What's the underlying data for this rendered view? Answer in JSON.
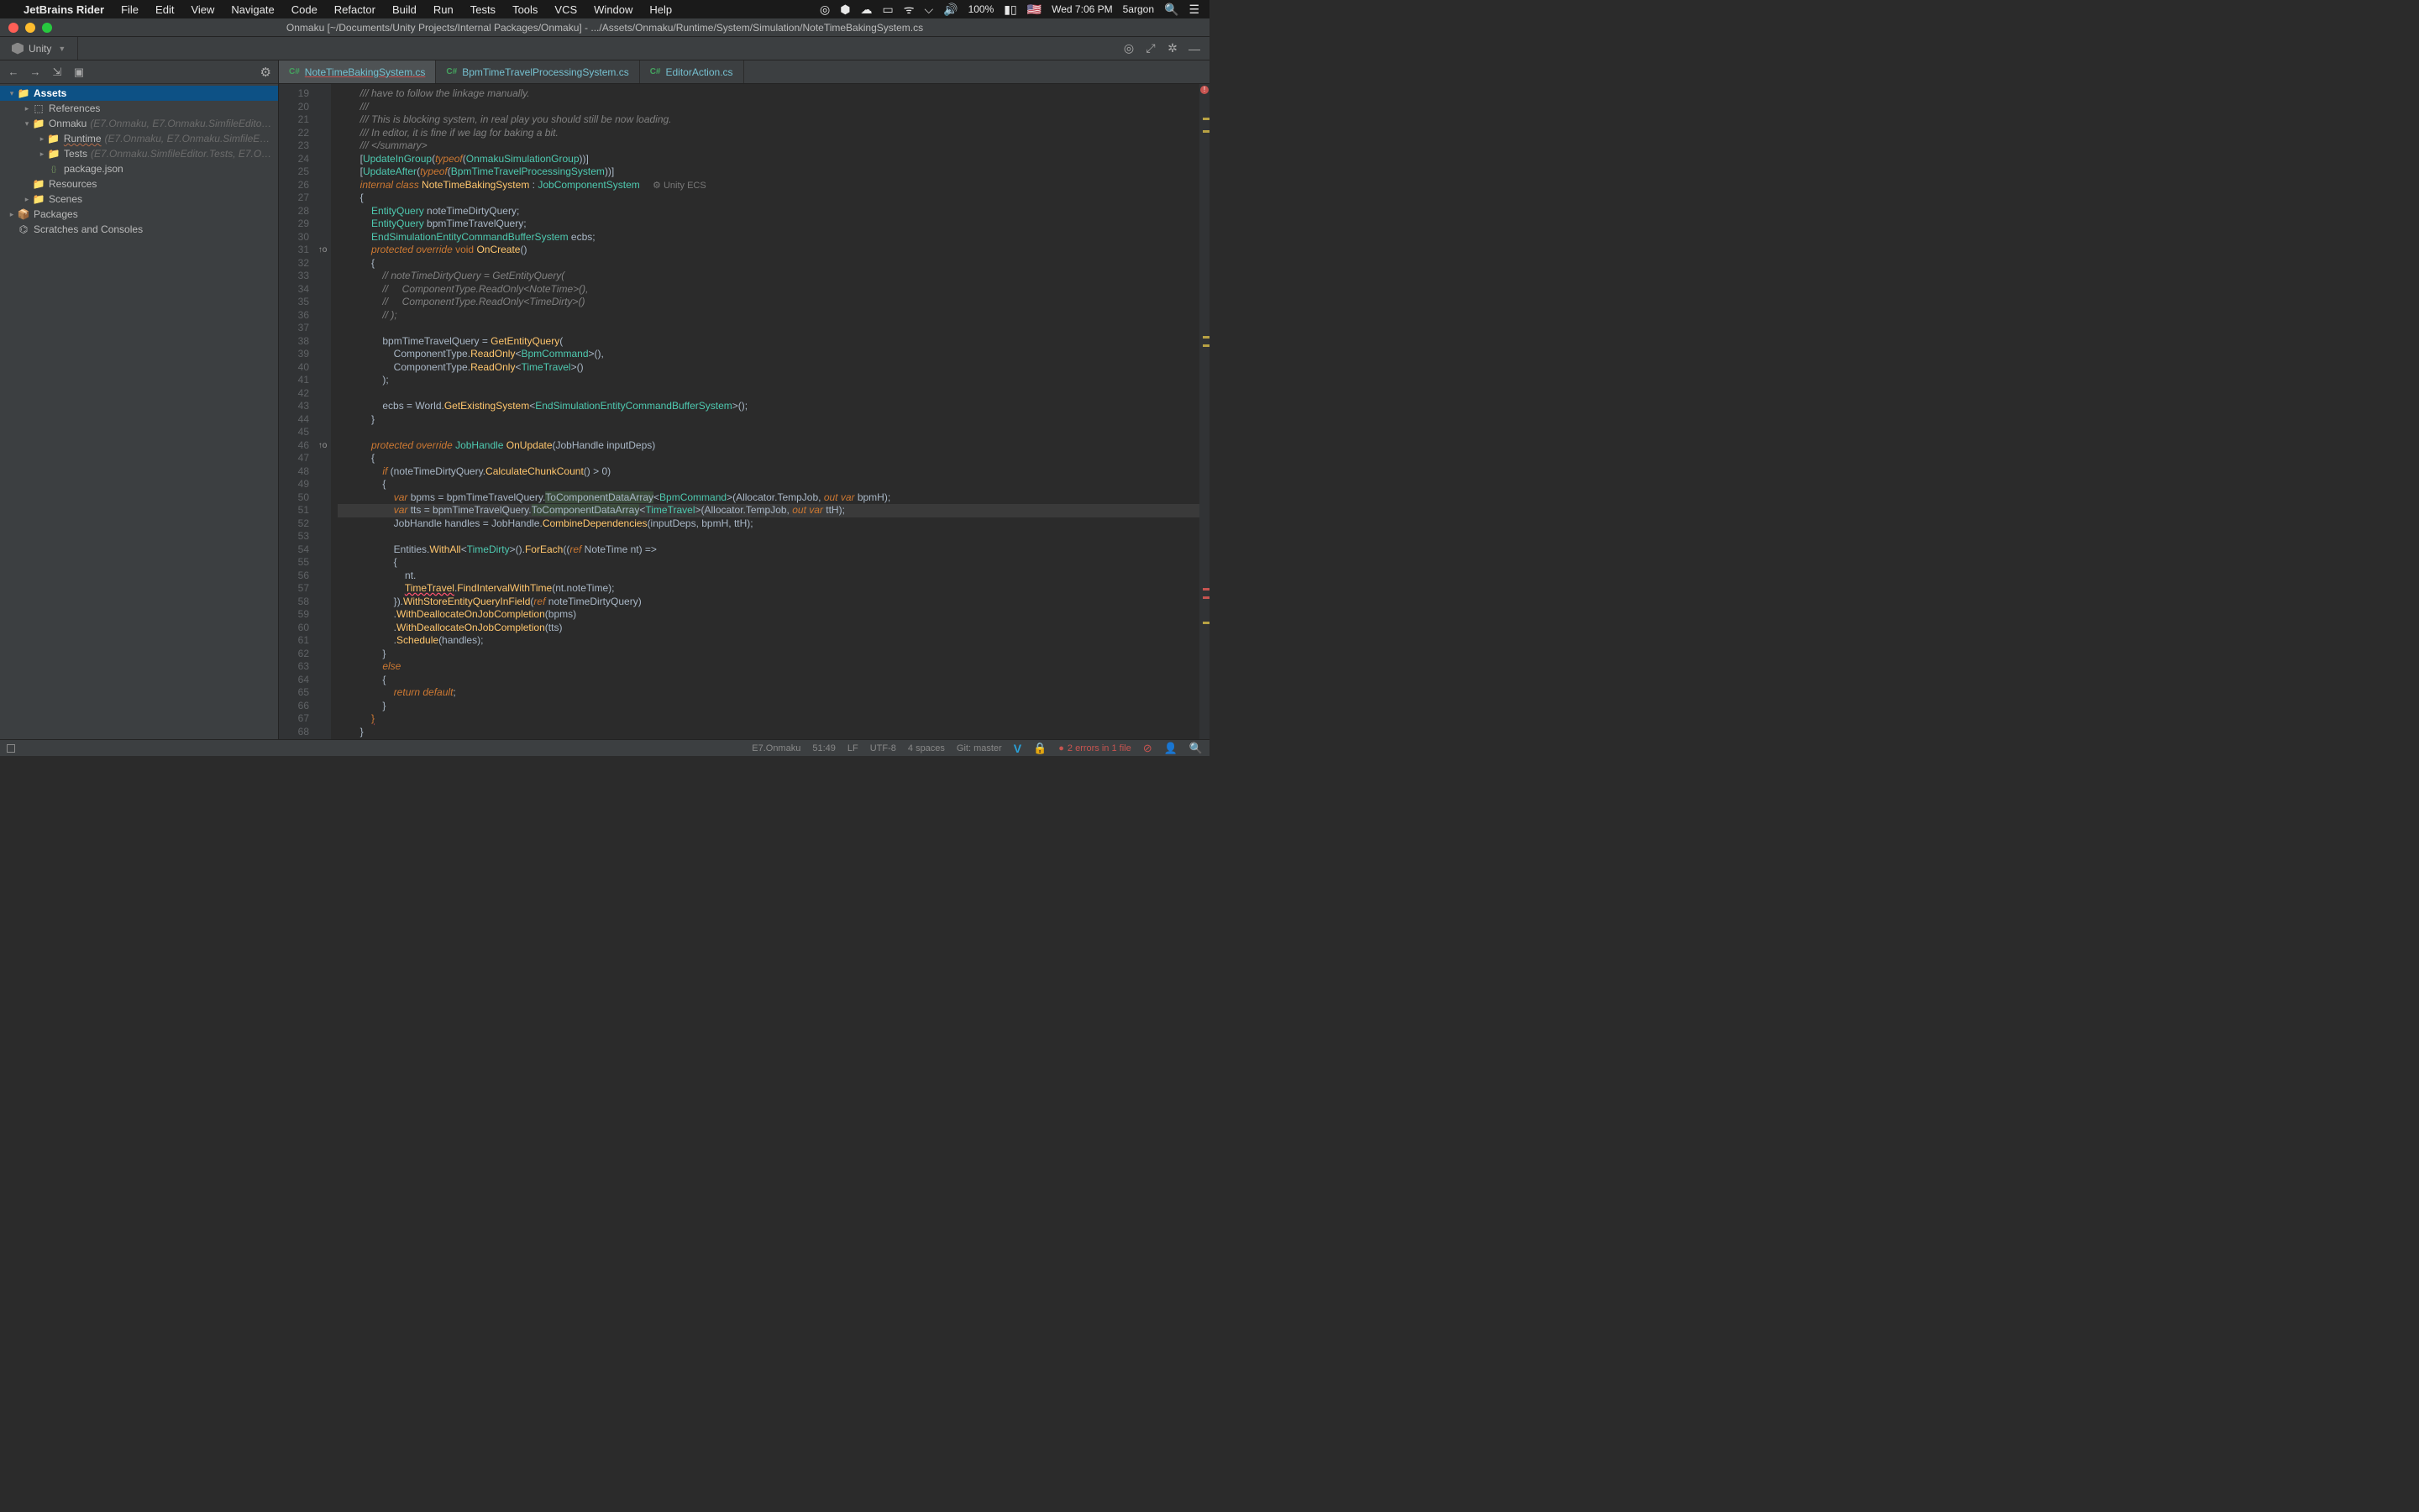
{
  "macos": {
    "appname": "JetBrains Rider",
    "menus": [
      "File",
      "Edit",
      "View",
      "Navigate",
      "Code",
      "Refactor",
      "Build",
      "Run",
      "Tests",
      "Tools",
      "VCS",
      "Window",
      "Help"
    ],
    "battery": "100%",
    "clock": "Wed 7:06 PM",
    "user": "5argon"
  },
  "window": {
    "title": "Onmaku [~/Documents/Unity Projects/Internal Packages/Onmaku] - .../Assets/Onmaku/Runtime/System/Simulation/NoteTimeBakingSystem.cs"
  },
  "toolbar": {
    "unity_label": "Unity"
  },
  "project": {
    "rows": [
      {
        "depth": 0,
        "exp": "▾",
        "icon": "folder",
        "label": "Assets",
        "selected": true
      },
      {
        "depth": 1,
        "exp": "▸",
        "icon": "ref",
        "label": "References"
      },
      {
        "depth": 1,
        "exp": "▾",
        "icon": "folder",
        "label": "Onmaku",
        "hint": "(E7.Onmaku, E7.Onmaku.SimfileEditor…"
      },
      {
        "depth": 2,
        "exp": "▸",
        "icon": "folder",
        "label": "Runtime",
        "hint": "(E7.Onmaku, E7.Onmaku.SimfileEd…",
        "runtime": true
      },
      {
        "depth": 2,
        "exp": "▸",
        "icon": "folder",
        "label": "Tests",
        "hint": "(E7.Onmaku.SimfileEditor.Tests, E7.O…"
      },
      {
        "depth": 2,
        "exp": "",
        "icon": "json",
        "label": "package.json"
      },
      {
        "depth": 1,
        "exp": "",
        "icon": "folder",
        "label": "Resources"
      },
      {
        "depth": 1,
        "exp": "▸",
        "icon": "folder",
        "label": "Scenes"
      },
      {
        "depth": 0,
        "exp": "▸",
        "icon": "pkg",
        "label": "Packages"
      },
      {
        "depth": 0,
        "exp": "",
        "icon": "scratch",
        "label": "Scratches and Consoles"
      }
    ]
  },
  "tabs": [
    {
      "lang": "C#",
      "name": "NoteTimeBakingSystem.cs",
      "active": true
    },
    {
      "lang": "C#",
      "name": "BpmTimeTravelProcessingSystem.cs",
      "active": false
    },
    {
      "lang": "C#",
      "name": "EditorAction.cs",
      "active": false
    }
  ],
  "line_start": 19,
  "line_end": 68,
  "current_line": 51,
  "markers": {
    "31": "↑o",
    "46": "↑o"
  },
  "inlay": {
    "26": "⚙ Unity ECS"
  },
  "code_lines": [
    [
      [
        "comment",
        "/// have to follow the linkage manually."
      ]
    ],
    [
      [
        "comment",
        "///"
      ]
    ],
    [
      [
        "comment",
        "/// This is blocking system, in real play you should still be now loading."
      ]
    ],
    [
      [
        "comment",
        "/// In editor, it is fine if we lag for baking a bit."
      ]
    ],
    [
      [
        "comment",
        "/// </summary>"
      ]
    ],
    [
      [
        "p",
        "["
      ],
      [
        "teal",
        "UpdateInGroup"
      ],
      [
        "p",
        "("
      ],
      [
        "kw-i",
        "typeof"
      ],
      [
        "p",
        "("
      ],
      [
        "teal",
        "OnmakuSimulationGroup"
      ],
      [
        "p",
        "))]"
      ]
    ],
    [
      [
        "p",
        "["
      ],
      [
        "teal",
        "UpdateAfter"
      ],
      [
        "p",
        "("
      ],
      [
        "kw-i",
        "typeof"
      ],
      [
        "p",
        "("
      ],
      [
        "teal",
        "BpmTimeTravelProcessingSystem"
      ],
      [
        "p",
        "))]"
      ]
    ],
    [
      [
        "kw-i",
        "internal class "
      ],
      [
        "type2",
        "NoteTimeBakingSystem"
      ],
      [
        "p",
        " : "
      ],
      [
        "teal",
        "JobComponentSystem"
      ]
    ],
    [
      [
        "p",
        "{"
      ]
    ],
    [
      [
        "p",
        "    "
      ],
      [
        "teal",
        "EntityQuery"
      ],
      [
        "p",
        " noteTimeDirtyQuery;"
      ]
    ],
    [
      [
        "p",
        "    "
      ],
      [
        "teal",
        "EntityQuery"
      ],
      [
        "p",
        " bpmTimeTravelQuery;"
      ]
    ],
    [
      [
        "p",
        "    "
      ],
      [
        "teal",
        "EndSimulationEntityCommandBufferSystem"
      ],
      [
        "p",
        " ecbs;"
      ]
    ],
    [
      [
        "p",
        "    "
      ],
      [
        "kw-i",
        "protected override "
      ],
      [
        "kw",
        "void "
      ],
      [
        "fn",
        "OnCreate"
      ],
      [
        "p",
        "()"
      ]
    ],
    [
      [
        "p",
        "    {"
      ]
    ],
    [
      [
        "p",
        "        "
      ],
      [
        "comment",
        "// noteTimeDirtyQuery = GetEntityQuery("
      ]
    ],
    [
      [
        "p",
        "        "
      ],
      [
        "comment",
        "//     ComponentType.ReadOnly<NoteTime>(),"
      ]
    ],
    [
      [
        "p",
        "        "
      ],
      [
        "comment",
        "//     ComponentType.ReadOnly<TimeDirty>()"
      ]
    ],
    [
      [
        "p",
        "        "
      ],
      [
        "comment",
        "// );"
      ]
    ],
    [
      [
        "p",
        ""
      ]
    ],
    [
      [
        "p",
        "        bpmTimeTravelQuery = "
      ],
      [
        "fn",
        "GetEntityQuery"
      ],
      [
        "p",
        "("
      ]
    ],
    [
      [
        "p",
        "            ComponentType."
      ],
      [
        "fn",
        "ReadOnly"
      ],
      [
        "p",
        "<"
      ],
      [
        "teal",
        "BpmCommand"
      ],
      [
        "p",
        ">(),"
      ]
    ],
    [
      [
        "p",
        "            ComponentType."
      ],
      [
        "fn",
        "ReadOnly"
      ],
      [
        "p",
        "<"
      ],
      [
        "teal",
        "TimeTravel"
      ],
      [
        "p",
        ">()"
      ]
    ],
    [
      [
        "p",
        "        );"
      ]
    ],
    [
      [
        "p",
        ""
      ]
    ],
    [
      [
        "p",
        "        ecbs = World."
      ],
      [
        "fn",
        "GetExistingSystem"
      ],
      [
        "p",
        "<"
      ],
      [
        "teal",
        "EndSimulationEntityCommandBufferSystem"
      ],
      [
        "p",
        ">();"
      ]
    ],
    [
      [
        "p",
        "    }"
      ]
    ],
    [
      [
        "p",
        ""
      ]
    ],
    [
      [
        "p",
        "    "
      ],
      [
        "kw-i",
        "protected override "
      ],
      [
        "teal",
        "JobHandle "
      ],
      [
        "fn",
        "OnUpdate"
      ],
      [
        "p",
        "(JobHandle inputDeps)"
      ]
    ],
    [
      [
        "p",
        "    {"
      ]
    ],
    [
      [
        "p",
        "        "
      ],
      [
        "kw-i",
        "if"
      ],
      [
        "p",
        " (noteTimeDirtyQuery."
      ],
      [
        "fn",
        "CalculateChunkCount"
      ],
      [
        "p",
        "() > 0)"
      ]
    ],
    [
      [
        "p",
        "        {"
      ]
    ],
    [
      [
        "p",
        "            "
      ],
      [
        "kw-i",
        "var"
      ],
      [
        "p",
        " bpms = bpmTimeTravelQuery."
      ],
      [
        "usg",
        "ToComponentDataArray"
      ],
      [
        "p",
        "<"
      ],
      [
        "teal",
        "BpmCommand"
      ],
      [
        "p",
        ">(Allocator.TempJob, "
      ],
      [
        "kw-i",
        "out var"
      ],
      [
        "p",
        " bpmH);"
      ]
    ],
    [
      [
        "p",
        "            "
      ],
      [
        "kw-i",
        "var"
      ],
      [
        "p",
        " tts = bpmTimeTravelQuery."
      ],
      [
        "usg",
        "ToComponentDataArray"
      ],
      [
        "p",
        "<"
      ],
      [
        "teal",
        "TimeTravel"
      ],
      [
        "p",
        ">(Allocator.TempJob, "
      ],
      [
        "kw-i",
        "out var"
      ],
      [
        "p",
        " ttH);"
      ]
    ],
    [
      [
        "p",
        "            JobHandle handles = JobHandle."
      ],
      [
        "fn",
        "CombineDependencies"
      ],
      [
        "p",
        "(inputDeps, bpmH, ttH);"
      ]
    ],
    [
      [
        "p",
        ""
      ]
    ],
    [
      [
        "p",
        "            Entities."
      ],
      [
        "fn",
        "WithAll"
      ],
      [
        "p",
        "<"
      ],
      [
        "teal",
        "TimeDirty"
      ],
      [
        "p",
        ">()."
      ],
      [
        "fn",
        "ForEach"
      ],
      [
        "p",
        "(("
      ],
      [
        "kw-i",
        "ref"
      ],
      [
        "p",
        " NoteTime nt) =>"
      ]
    ],
    [
      [
        "p",
        "            {"
      ]
    ],
    [
      [
        "p",
        "                nt."
      ]
    ],
    [
      [
        "p",
        "                "
      ],
      [
        "err",
        "TimeTravel"
      ],
      [
        "p",
        "."
      ],
      [
        "fn",
        "FindIntervalWithTime"
      ],
      [
        "p",
        "(nt.noteTime);"
      ]
    ],
    [
      [
        "p",
        "            })."
      ],
      [
        "fn",
        "WithStoreEntityQueryInField"
      ],
      [
        "p",
        "("
      ],
      [
        "kw-i",
        "ref"
      ],
      [
        "p",
        " noteTimeDirtyQuery)"
      ]
    ],
    [
      [
        "p",
        "            ."
      ],
      [
        "fn",
        "WithDeallocateOnJobCompletion"
      ],
      [
        "p",
        "(bpms)"
      ]
    ],
    [
      [
        "p",
        "            ."
      ],
      [
        "fn",
        "WithDeallocateOnJobCompletion"
      ],
      [
        "p",
        "(tts)"
      ]
    ],
    [
      [
        "p",
        "            ."
      ],
      [
        "fn",
        "Schedule"
      ],
      [
        "p",
        "(handles);"
      ]
    ],
    [
      [
        "p",
        "        }"
      ]
    ],
    [
      [
        "p",
        "        "
      ],
      [
        "kw-i",
        "else"
      ]
    ],
    [
      [
        "p",
        "        {"
      ]
    ],
    [
      [
        "p",
        "            "
      ],
      [
        "kw-i",
        "return default"
      ],
      [
        "p",
        ";"
      ]
    ],
    [
      [
        "p",
        "        }"
      ]
    ],
    [
      [
        "p",
        "    "
      ],
      [
        "errbr",
        "}"
      ]
    ],
    [
      [
        "p",
        "}"
      ]
    ]
  ],
  "statusbar": {
    "context": "E7.Onmaku",
    "pos": "51:49",
    "eol": "LF",
    "enc": "UTF-8",
    "indent": "4 spaces",
    "git": "Git: master",
    "errors": "2 errors in 1 file"
  }
}
